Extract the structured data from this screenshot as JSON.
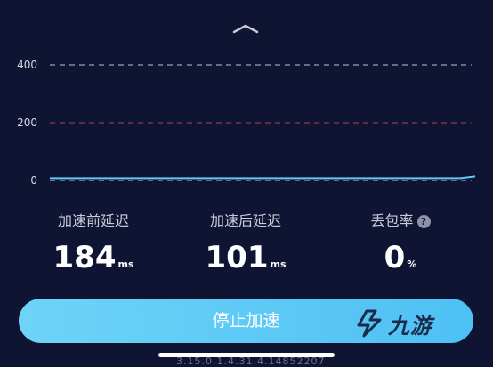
{
  "chart_data": {
    "type": "line",
    "y_ticks": [
      "400",
      "200",
      "0"
    ],
    "ylim": [
      0,
      400
    ],
    "threshold_lines": [
      {
        "value": 400,
        "color": "#9aa0b8"
      },
      {
        "value": 200,
        "color": "#8a3a4a"
      },
      {
        "value": 0,
        "color": "#9aa0b8"
      }
    ],
    "series": [
      {
        "color": "#5ecbf5",
        "values": [
          8,
          8,
          8,
          8,
          8,
          8,
          8,
          8,
          8,
          8,
          8,
          8,
          8,
          8,
          8,
          8,
          8,
          8,
          8,
          8,
          8,
          8,
          8,
          8,
          8,
          8,
          8,
          8,
          8,
          14
        ]
      }
    ]
  },
  "stats": {
    "before": {
      "label": "加速前延迟",
      "value": "184",
      "unit": "ms"
    },
    "after": {
      "label": "加速后延迟",
      "value": "101",
      "unit": "ms"
    },
    "loss": {
      "label": "丢包率",
      "value": "0",
      "unit": "%",
      "help": "?"
    }
  },
  "button": {
    "label": "停止加速"
  },
  "watermark": {
    "text": "九游"
  },
  "version": "3.15.0.1.4.31.4.14852207",
  "colors": {
    "background": "#0f1433",
    "accent": "#5ecbf5",
    "button": "#5cc8f5"
  }
}
